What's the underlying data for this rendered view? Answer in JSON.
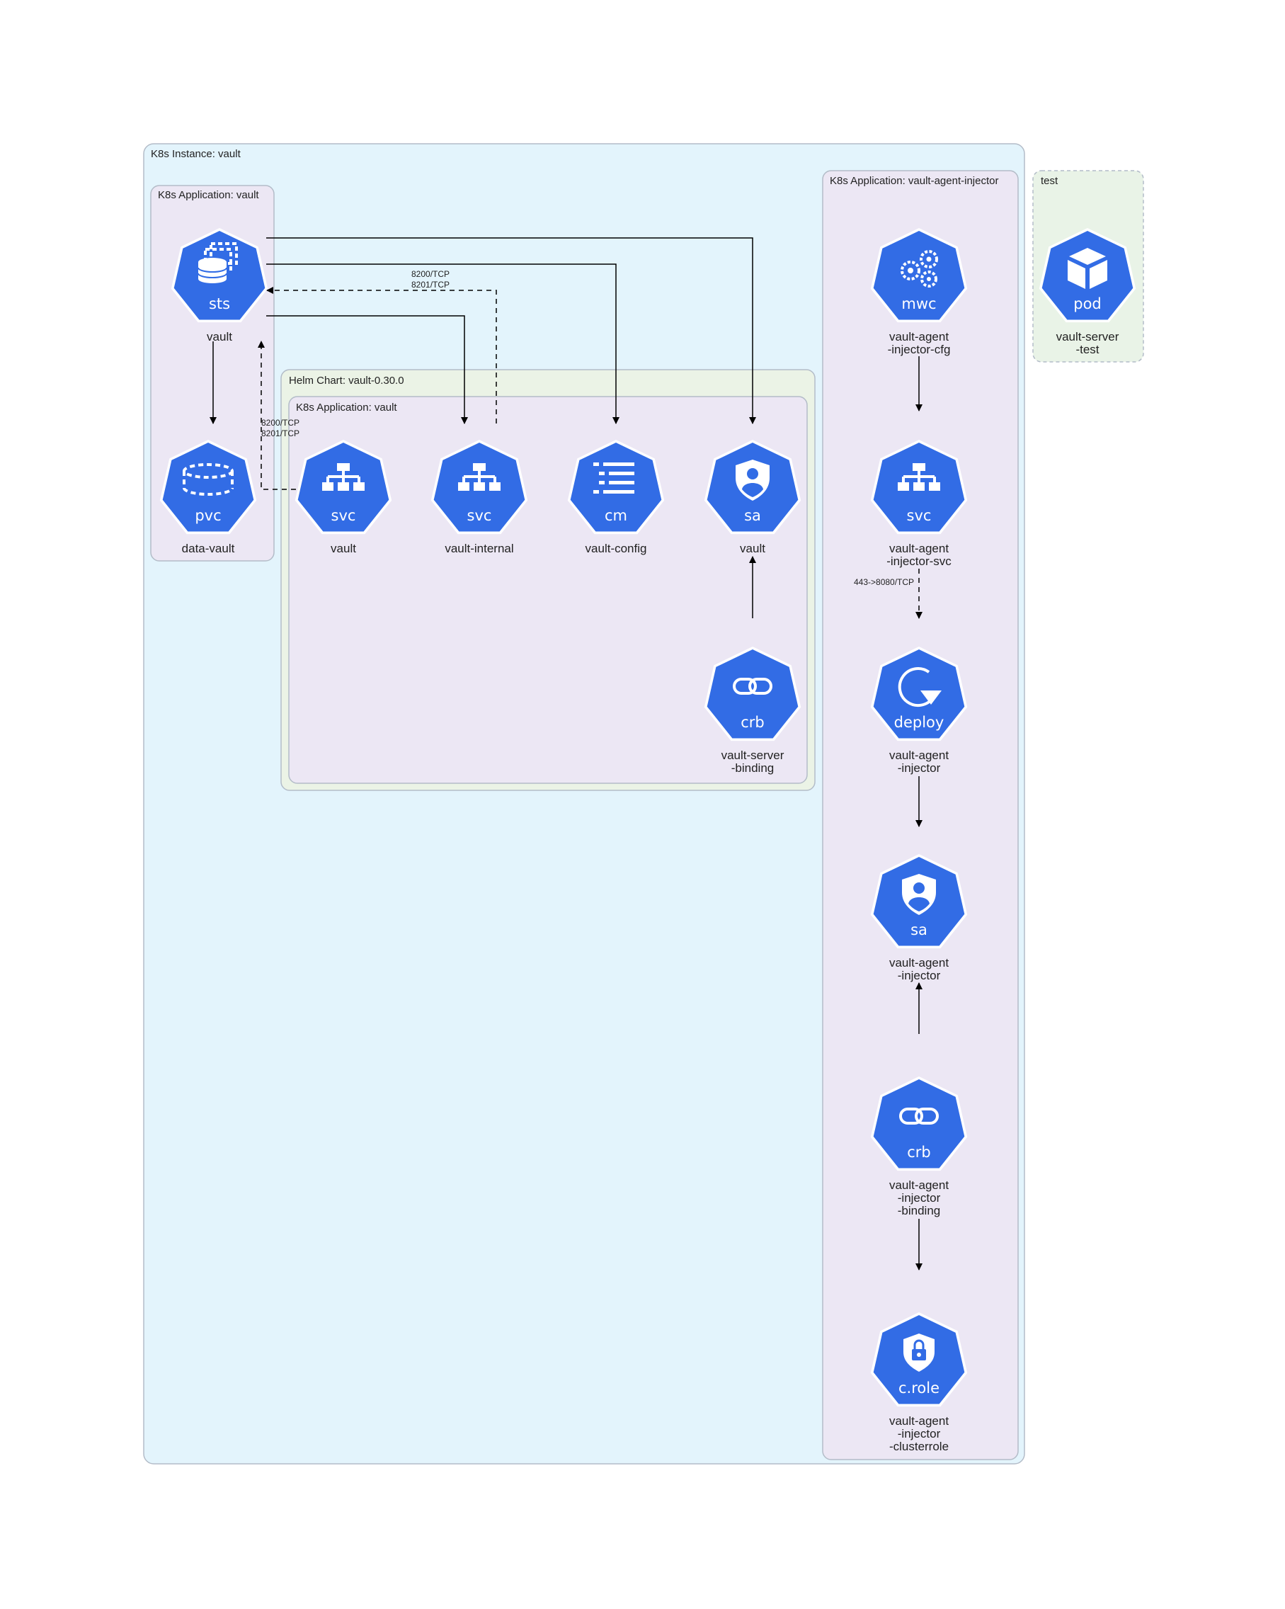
{
  "colors": {
    "hex_fill": "#326ce5",
    "instance_fill": "#e3f4fc",
    "application_fill": "#ece7f4",
    "helm_fill": "#ebf3e6",
    "test_fill": "#e9f3e7",
    "cluster_stroke": "#b3bcc8"
  },
  "clusters": {
    "instance": "K8s Instance: vault",
    "app_vault": "K8s Application: vault",
    "helm": "Helm Chart: vault-0.30.0",
    "helm_app_vault": "K8s Application: vault",
    "injector_app": "K8s Application: vault-agent-injector",
    "test": "test"
  },
  "nodes": {
    "sts_vault": {
      "kind": "sts",
      "icon": "statefulset-icon",
      "label": [
        "vault"
      ]
    },
    "pvc_data_vault": {
      "kind": "pvc",
      "icon": "volume-claim-icon",
      "label": [
        "data-vault"
      ]
    },
    "svc_vault": {
      "kind": "svc",
      "icon": "service-network-icon",
      "label": [
        "vault"
      ]
    },
    "svc_vault_internal": {
      "kind": "svc",
      "icon": "service-network-icon",
      "label": [
        "vault-internal"
      ]
    },
    "cm_vault_config": {
      "kind": "cm",
      "icon": "config-map-list-icon",
      "label": [
        "vault-config"
      ]
    },
    "sa_vault": {
      "kind": "sa",
      "icon": "service-account-shield-icon",
      "label": [
        "vault"
      ]
    },
    "crb_vault_server_binding": {
      "kind": "crb",
      "icon": "role-binding-link-icon",
      "label": [
        "vault-server",
        "-binding"
      ]
    },
    "mwc_injector_cfg": {
      "kind": "mwc",
      "icon": "webhook-gears-icon",
      "label": [
        "vault-agent",
        "-injector-cfg"
      ]
    },
    "svc_injector_svc": {
      "kind": "svc",
      "icon": "service-network-icon",
      "label": [
        "vault-agent",
        "-injector-svc"
      ]
    },
    "deploy_injector": {
      "kind": "deploy",
      "icon": "deployment-rotate-icon",
      "label": [
        "vault-agent",
        "-injector"
      ]
    },
    "sa_injector": {
      "kind": "sa",
      "icon": "service-account-shield-icon",
      "label": [
        "vault-agent",
        "-injector"
      ]
    },
    "crb_injector_binding": {
      "kind": "crb",
      "icon": "role-binding-link-icon",
      "label": [
        "vault-agent",
        "-injector",
        "-binding"
      ]
    },
    "crole_injector_clusterrole": {
      "kind": "c.role",
      "icon": "cluster-role-lock-icon",
      "label": [
        "vault-agent",
        "-injector",
        "-clusterrole"
      ]
    },
    "pod_server_test": {
      "kind": "pod",
      "icon": "pod-cube-icon",
      "label": [
        "vault-server",
        "-test"
      ]
    }
  },
  "edges": {
    "internal_to_sts_ports": [
      "8200/TCP",
      "8201/TCP"
    ],
    "svc_to_sts_ports": [
      "8200/TCP",
      "8201/TCP"
    ],
    "injector_svc_to_deploy_port": "443->8080/TCP"
  }
}
